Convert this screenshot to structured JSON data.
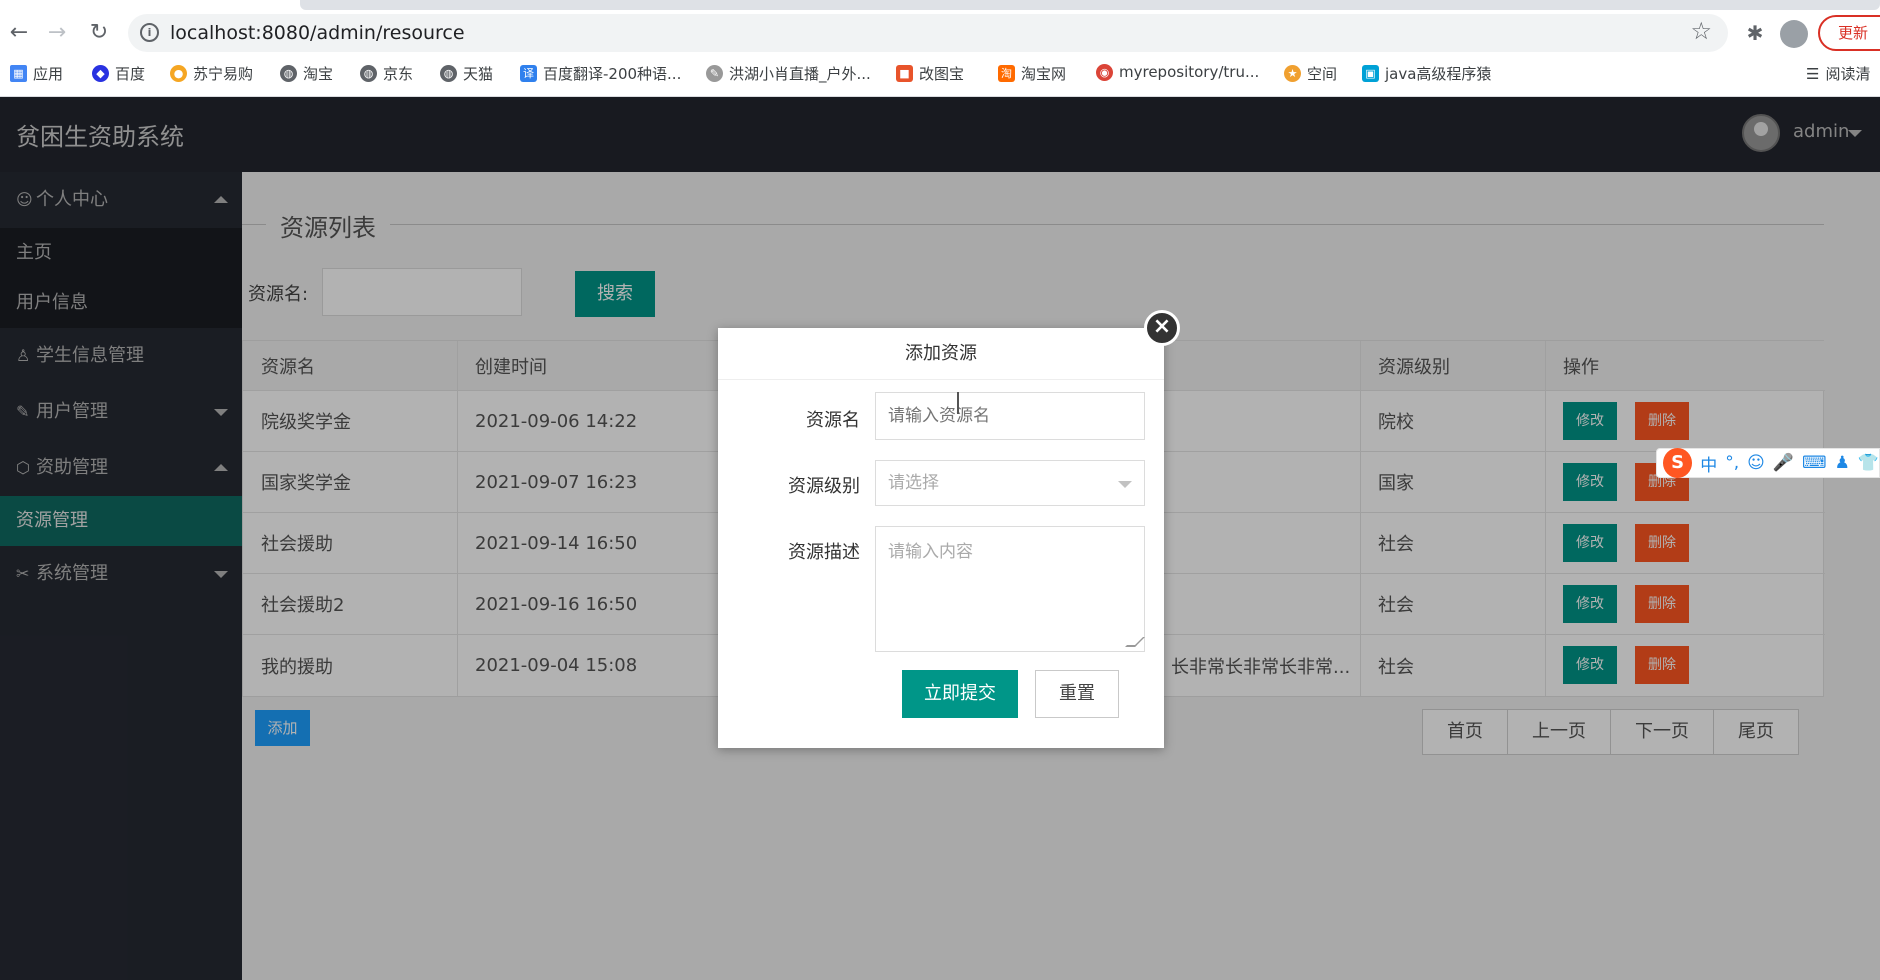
{
  "browser": {
    "url": "localhost:8080/admin/resource",
    "update_label": "更新",
    "bookmarks": [
      {
        "label": "应用",
        "icon": "apps-grid-icon"
      },
      {
        "label": "百度",
        "icon": "baidu-icon"
      },
      {
        "label": "苏宁易购",
        "icon": "suning-icon"
      },
      {
        "label": "淘宝",
        "icon": "globe-icon"
      },
      {
        "label": "京东",
        "icon": "globe-icon"
      },
      {
        "label": "天猫",
        "icon": "globe-icon"
      },
      {
        "label": "百度翻译-200种语...",
        "icon": "translate-icon"
      },
      {
        "label": "洪湖小肖直播_户外...",
        "icon": "live-icon"
      },
      {
        "label": "改图宝",
        "icon": "gaitubao-icon"
      },
      {
        "label": "淘宝网",
        "icon": "taobao-icon"
      },
      {
        "label": "myrepository/tru...",
        "icon": "chrome-icon"
      },
      {
        "label": "空间",
        "icon": "qzone-icon"
      },
      {
        "label": "java高级程序猿",
        "icon": "bilibili-icon"
      }
    ],
    "reading_list": "阅读清"
  },
  "header": {
    "title": "贫困生资助系统",
    "username": "admin"
  },
  "sidebar": {
    "groups": [
      {
        "label": "个人中心",
        "icon": "user-icon",
        "expanded": true,
        "items": [
          "主页",
          "用户信息"
        ]
      },
      {
        "label": "学生信息管理",
        "icon": "person-icon",
        "expanded": false,
        "items": []
      },
      {
        "label": "用户管理",
        "icon": "edit-icon",
        "expanded": false,
        "items": []
      },
      {
        "label": "资助管理",
        "icon": "cube-icon",
        "expanded": true,
        "items": [
          "资源管理"
        ]
      },
      {
        "label": "系统管理",
        "icon": "tools-icon",
        "expanded": false,
        "items": []
      }
    ]
  },
  "main": {
    "section_title": "资源列表",
    "search_label": "资源名:",
    "search_button": "搜索",
    "table": {
      "headers": [
        "资源名",
        "创建时间",
        "资源级别",
        "操作"
      ],
      "rows": [
        {
          "name": "院级奖学金",
          "created": "2021-09-06 14:22",
          "desc": "",
          "level": "院校"
        },
        {
          "name": "国家奖学金",
          "created": "2021-09-07 16:23",
          "desc": "",
          "level": "国家"
        },
        {
          "name": "社会援助",
          "created": "2021-09-14 16:50",
          "desc": "",
          "level": "社会"
        },
        {
          "name": "社会援助2",
          "created": "2021-09-16 16:50",
          "desc": "",
          "level": "社会"
        },
        {
          "name": "我的援助",
          "created": "2021-09-04 15:08",
          "desc": "长非常长非常长非常...",
          "level": "社会"
        }
      ],
      "edit_label": "修改",
      "delete_label": "删除"
    },
    "add_button": "添加",
    "pager": [
      "首页",
      "上一页",
      "下一页",
      "尾页"
    ]
  },
  "modal": {
    "title": "添加资源",
    "name_label": "资源名",
    "name_placeholder": "请输入资源名",
    "level_label": "资源级别",
    "level_placeholder": "请选择",
    "desc_label": "资源描述",
    "desc_placeholder": "请输入内容",
    "submit_label": "立即提交",
    "reset_label": "重置"
  },
  "ime": {
    "labels": [
      "中",
      "°,"
    ]
  }
}
